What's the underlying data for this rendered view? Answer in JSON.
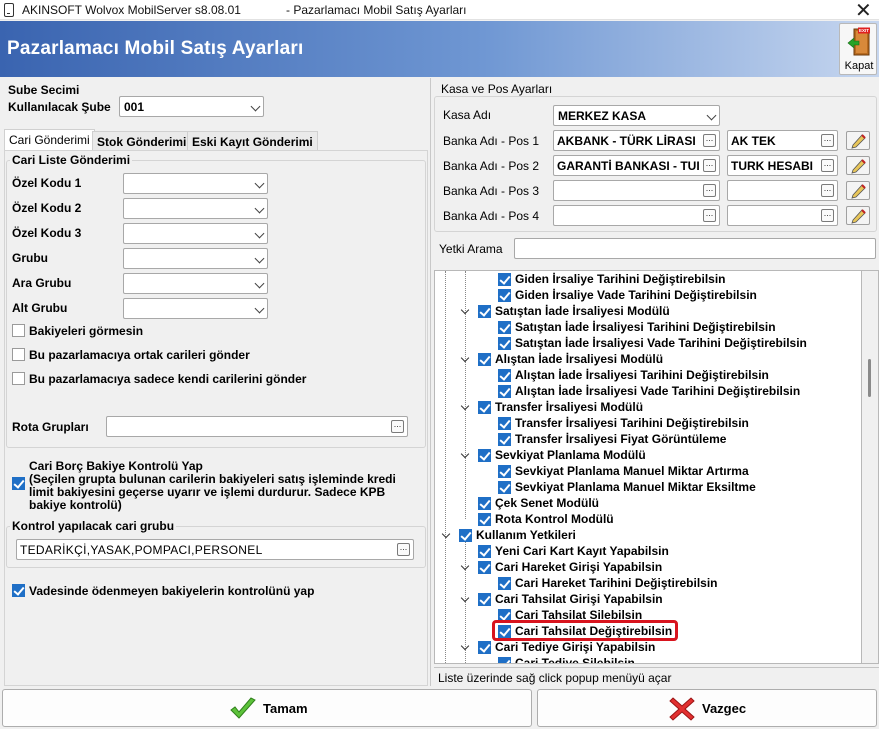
{
  "window": {
    "title": "AKINSOFT Wolvox MobilServer s8.08.01",
    "subtitle": "- Pazarlamacı Mobil Satış Ayarları",
    "close_glyph": "✕"
  },
  "banner": {
    "title": "Pazarlamacı Mobil Satış Ayarları",
    "exit_label": "Kapat",
    "exit_sign": "EXIT"
  },
  "left": {
    "branch_group": "Sube Secimi",
    "branch_label": "Kullanılacak Şube",
    "branch_value": "001",
    "tabs": [
      "Cari Gönderimi",
      "Stok Gönderimi",
      "Eski Kayıt Gönderimi"
    ],
    "cari_group": "Cari Liste Gönderimi",
    "filters": [
      "Özel Kodu 1",
      "Özel Kodu 2",
      "Özel Kodu 3",
      "Grubu",
      "Ara Grubu",
      "Alt Grubu"
    ],
    "checks": [
      "Bakiyeleri görmesin",
      "Bu pazarlamacıya ortak carileri gönder",
      "Bu pazarlamacıya sadece kendi carilerini gönder"
    ],
    "rota_label": "Rota Grupları",
    "borc_title": "Cari Borç Bakiye Kontrolü Yap",
    "borc_desc1": "(Seçilen grupta bulunan carilerin bakiyeleri satış işleminde kredi",
    "borc_desc2": "limit bakiyesini geçerse uyarır ve işlemi durdurur. Sadece KPB",
    "borc_desc3": "bakiye kontrolü)",
    "kontrol_group": "Kontrol yapılacak cari grubu",
    "kontrol_value": "TEDARİKÇİ,YASAK,POMPACI,PERSONEL",
    "vade_label": "Vadesinde ödenmeyen bakiyelerin kontrolünü yap"
  },
  "right": {
    "group_title": "Kasa ve Pos Ayarları",
    "kasa_label": "Kasa Adı",
    "kasa_value": "MERKEZ KASA",
    "banks": [
      {
        "label": "Banka Adı - Pos 1",
        "bank": "AKBANK - TÜRK LİRASI",
        "account": "AK TEK"
      },
      {
        "label": "Banka Adı - Pos 2",
        "bank": "GARANTİ BANKASI - TUI",
        "account": "TURK HESABI"
      },
      {
        "label": "Banka Adı - Pos 3",
        "bank": "",
        "account": ""
      },
      {
        "label": "Banka Adı - Pos 4",
        "bank": "",
        "account": ""
      }
    ],
    "yetki_label": "Yetki Arama",
    "tree": [
      {
        "text": "Giden İrsaliye Tarihini Değiştirebilsin",
        "level": 2
      },
      {
        "text": "Giden İrsaliye Vade Tarihini Değiştirebilsin",
        "level": 2
      },
      {
        "text": "Satıştan İade İrsaliyesi Modülü",
        "level": 1
      },
      {
        "text": "Satıştan İade İrsaliyesi Tarihini Değiştirebilsin",
        "level": 2
      },
      {
        "text": "Satıştan İade İrsaliyesi Vade Tarihini Değiştirebilsin",
        "level": 2
      },
      {
        "text": "Alıştan İade İrsaliyesi Modülü",
        "level": 1
      },
      {
        "text": "Alıştan İade İrsaliyesi Tarihini Değiştirebilsin",
        "level": 2
      },
      {
        "text": "Alıştan İade İrsaliyesi Vade Tarihini Değiştirebilsin",
        "level": 2
      },
      {
        "text": "Transfer İrsaliyesi Modülü",
        "level": 1
      },
      {
        "text": "Transfer İrsaliyesi Tarihini Değiştirebilsin",
        "level": 2
      },
      {
        "text": "Transfer İrsaliyesi Fiyat Görüntüleme",
        "level": 2
      },
      {
        "text": "Sevkiyat Planlama Modülü",
        "level": 1
      },
      {
        "text": "Sevkiyat Planlama Manuel Miktar Artırma",
        "level": 2
      },
      {
        "text": "Sevkiyat Planlama Manuel Miktar Eksiltme",
        "level": 2
      },
      {
        "text": "Çek Senet Modülü",
        "level": 1
      },
      {
        "text": "Rota Kontrol Modülü",
        "level": 1
      },
      {
        "text": "Kullanım Yetkileri",
        "level": 0
      },
      {
        "text": "Yeni Cari Kart Kayıt Yapabilsin",
        "level": 1
      },
      {
        "text": "Cari Hareket Girişi Yapabilsin",
        "level": 1
      },
      {
        "text": "Cari Hareket Tarihini Değiştirebilsin",
        "level": 2
      },
      {
        "text": "Cari Tahsilat Girişi Yapabilsin",
        "level": 1
      },
      {
        "text": "Cari Tahsilat Silebilsin",
        "level": 2
      },
      {
        "text": "Cari Tahsilat Değiştirebilsin",
        "level": 2
      },
      {
        "text": "Cari Tediye Girişi Yapabilsin",
        "level": 1
      },
      {
        "text": "Cari Tediye Silebilsin",
        "level": 2
      }
    ],
    "status": "Liste üzerinde sağ click popup menüyü açar"
  },
  "buttons": {
    "ok": "Tamam",
    "cancel": "Vazgec"
  },
  "colors": {
    "check_blue": "#1f6fc6",
    "highlight_red": "#d8141e",
    "banner_start": "#3a64b0"
  },
  "icons": [
    "checkmark-icon",
    "cross-icon",
    "exit-door-icon",
    "pencil-icon",
    "ellipsis-icon"
  ]
}
